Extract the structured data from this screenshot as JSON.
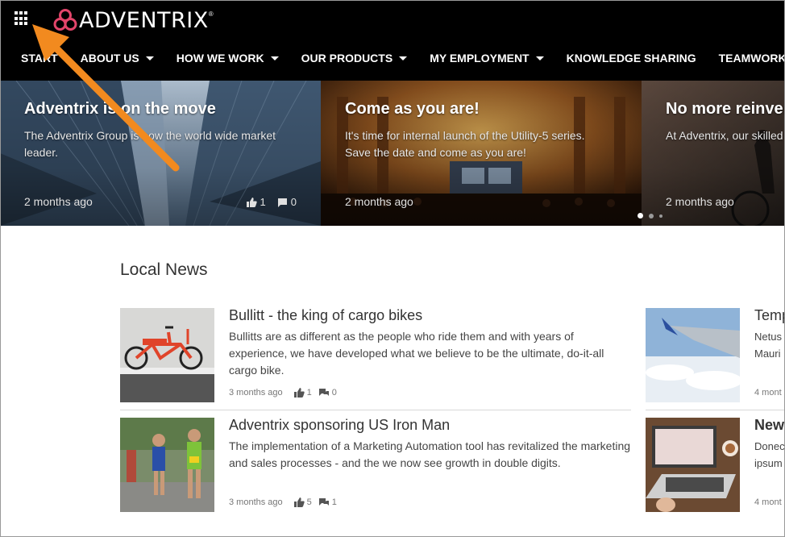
{
  "header": {
    "logo_text": "ADVENTRIX",
    "logo_reg": "®",
    "nav": [
      {
        "label": "START",
        "dropdown": false
      },
      {
        "label": "ABOUT US",
        "dropdown": true
      },
      {
        "label": "HOW WE WORK",
        "dropdown": true
      },
      {
        "label": "OUR PRODUCTS",
        "dropdown": true
      },
      {
        "label": "MY EMPLOYMENT",
        "dropdown": true
      },
      {
        "label": "KNOWLEDGE SHARING",
        "dropdown": false
      },
      {
        "label": "TEAMWORK",
        "dropdown": false
      }
    ]
  },
  "hero": {
    "slides": [
      {
        "title": "Adventrix is on the move",
        "text": "The Adventrix Group is now the world wide market leader.",
        "date": "2 months ago",
        "likes": "1",
        "comments": "0"
      },
      {
        "title": "Come as you are!",
        "text": "It's time for internal launch of the Utility-5 series. Save the date and come as you are!",
        "date": "2 months ago"
      },
      {
        "title": "No more reinventing",
        "text": "At Adventrix, our skilled employees are our most",
        "date": "2 months ago"
      }
    ],
    "active_slide": 1,
    "slide_count": 3
  },
  "local_news": {
    "title": "Local News",
    "items": [
      {
        "title": "Bullitt - the king of cargo bikes",
        "text": "Bullitts are as different as the people who ride them and with years of experience, we have developed what we believe to be the ultimate, do-it-all cargo bike.",
        "date": "3 months ago",
        "likes": "1",
        "comments": "0"
      },
      {
        "title": "Adventrix sponsoring US Iron Man",
        "text": "The implementation of a Marketing Automation tool has revitalized the marketing and sales processes - and the we now see growth in double digits.",
        "date": "3 months ago",
        "likes": "5",
        "comments": "1"
      }
    ],
    "right_items": [
      {
        "title": "Temp",
        "line1": "Netus",
        "line2": "Mauri",
        "date": "4 mont"
      },
      {
        "title": "New",
        "line1": "Donec",
        "line2": "ipsum",
        "date": "4 mont"
      }
    ]
  },
  "colors": {
    "header_bg": "#000000",
    "logo_mark": "#e2456a",
    "annotation_arrow": "#f28a1f"
  },
  "icons": [
    "apps-grid-icon",
    "adventrix-logo-icon",
    "thumbs-up-icon",
    "comment-icon",
    "chevron-down-icon"
  ]
}
